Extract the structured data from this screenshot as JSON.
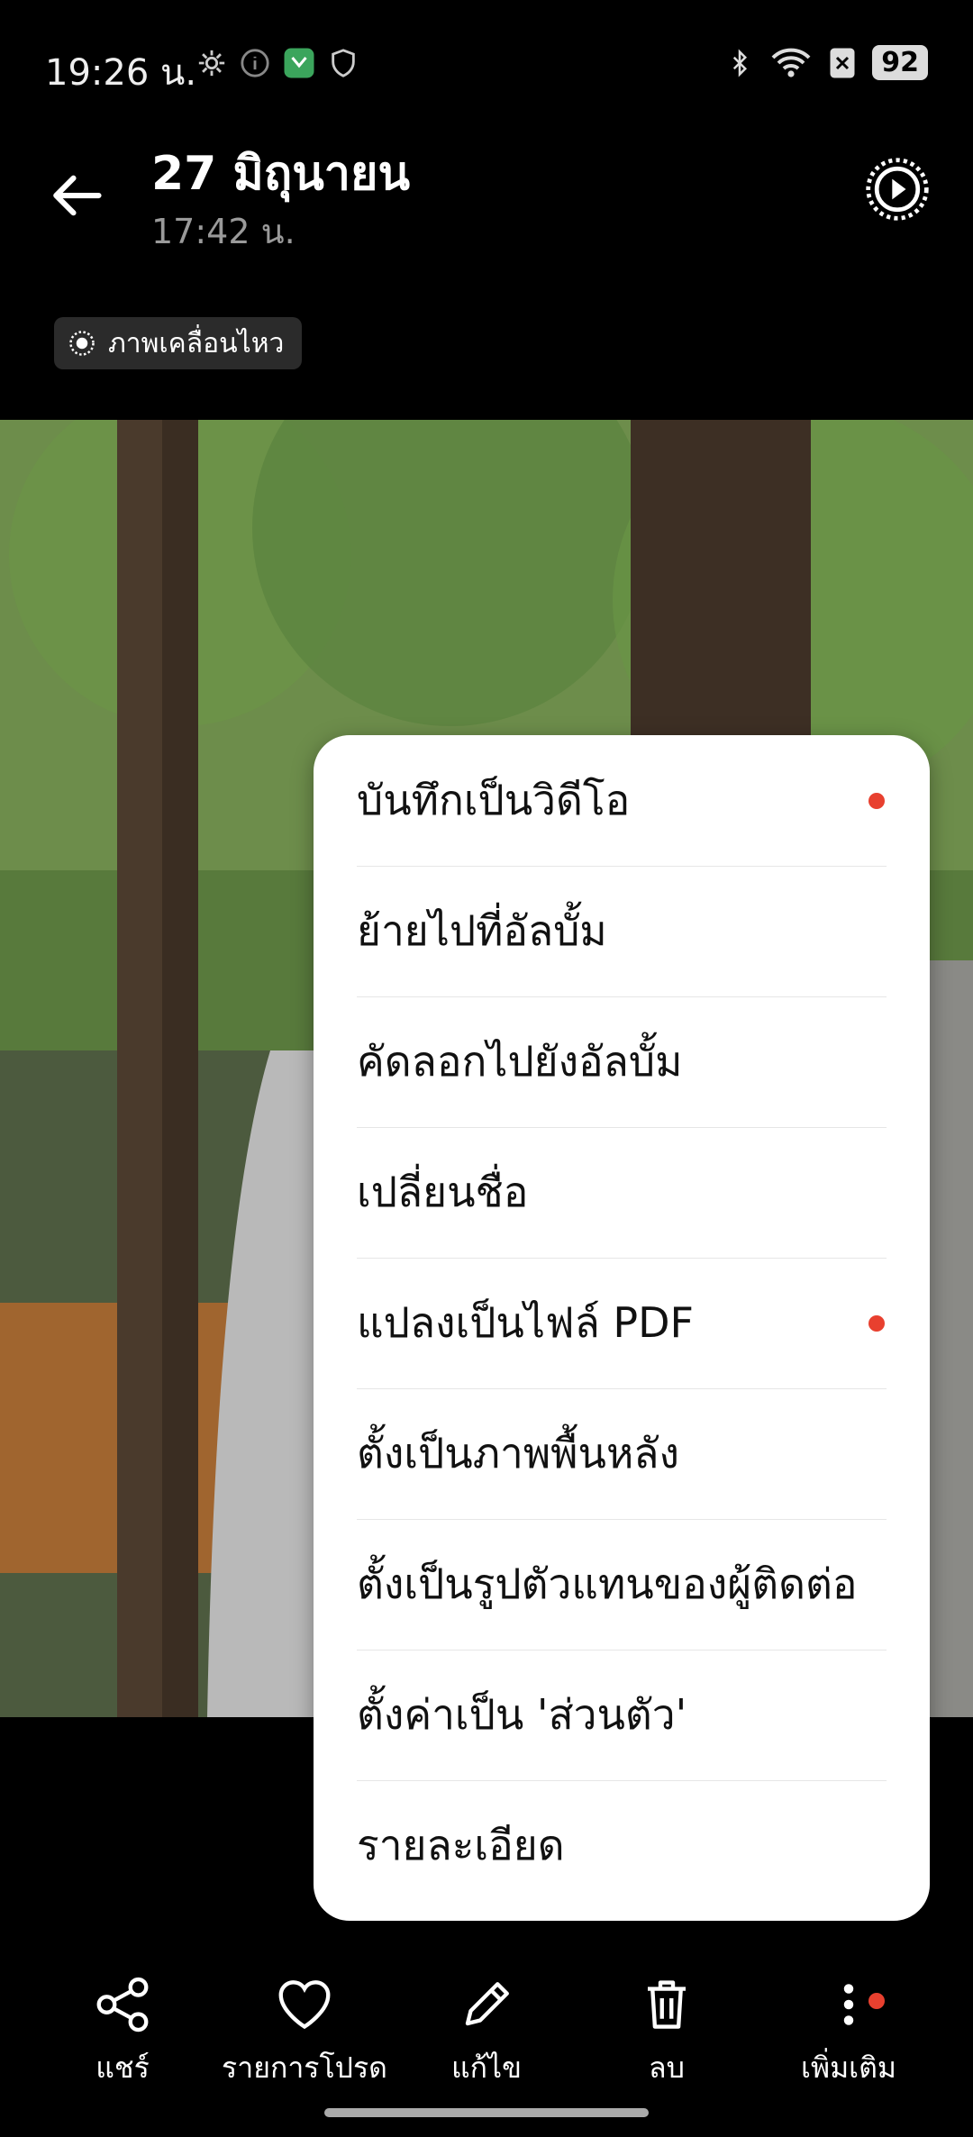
{
  "status": {
    "time": "19:26 น.",
    "battery": "92"
  },
  "header": {
    "title": "27 มิถุนายน",
    "subtitle": "17:42 น.",
    "chip_label": "ภาพเคลื่อนไหว"
  },
  "menu": {
    "items": [
      {
        "label": "บันทึกเป็นวิดีโอ",
        "dot": true
      },
      {
        "label": "ย้ายไปที่อัลบั้ม",
        "dot": false
      },
      {
        "label": "คัดลอกไปยังอัลบั้ม",
        "dot": false
      },
      {
        "label": "เปลี่ยนชื่อ",
        "dot": false
      },
      {
        "label": "แปลงเป็นไฟล์ PDF",
        "dot": true
      },
      {
        "label": "ตั้งเป็นภาพพื้นหลัง",
        "dot": false
      },
      {
        "label": "ตั้งเป็นรูปตัวแทนของผู้ติดต่อ",
        "dot": false
      },
      {
        "label": "ตั้งค่าเป็น 'ส่วนตัว'",
        "dot": false
      },
      {
        "label": "รายละเอียด",
        "dot": false
      }
    ]
  },
  "bottom_bar": {
    "share": "แชร์",
    "favorite": "รายการโปรด",
    "edit": "แก้ไข",
    "delete": "ลบ",
    "more": "เพิ่มเติม"
  },
  "colors": {
    "accent_dot": "#e8402f",
    "background": "#000000"
  }
}
